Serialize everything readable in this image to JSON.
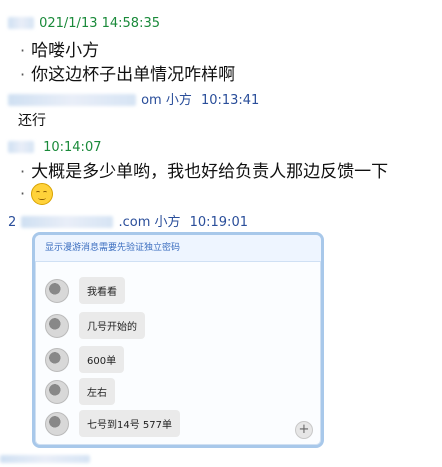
{
  "chat": {
    "block1": {
      "sender_suffix": "021/1/13 14:58:35",
      "lines": [
        "哈喽小方",
        "你这边杯子出单情况咋样啊"
      ]
    },
    "block2": {
      "sender_suffix": "om 小方",
      "time": "10:13:41",
      "lines": [
        "还行"
      ]
    },
    "block3": {
      "time": "10:14:07",
      "lines": [
        "大概是多少单哟，我也好给负责人那边反馈一下"
      ],
      "emoji": "smile-emoji"
    },
    "block4": {
      "sender_prefix": "2",
      "sender_suffix": ".com 小方",
      "time": "10:19:01"
    }
  },
  "embedded": {
    "bar_text": "显示漫游消息需要先验证独立密码",
    "messages": [
      "我看看",
      "几号开始的",
      "600单",
      "左右",
      "七号到14号 577单"
    ],
    "zoom_icon": "+"
  },
  "colors": {
    "timestamp_green": "#1a8a3a",
    "sender_blue": "#2a4e9a",
    "window_border": "#a8c8ea"
  }
}
